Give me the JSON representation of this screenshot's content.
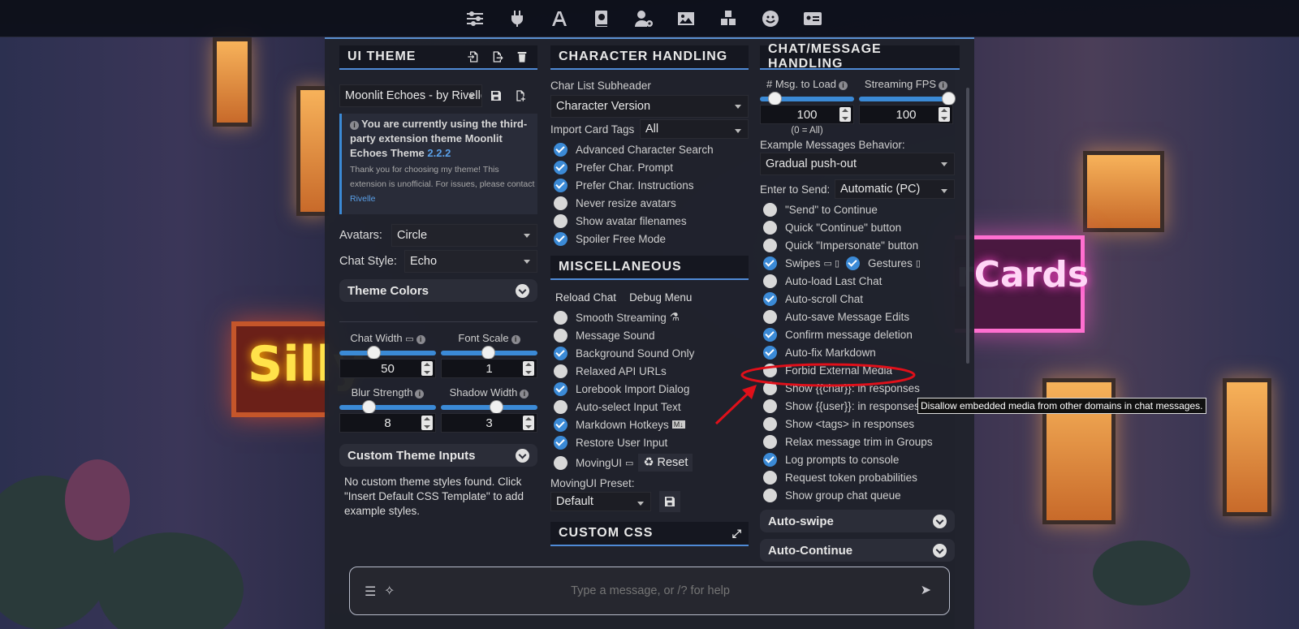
{
  "toolbar": {
    "icons": [
      "sliders-icon",
      "plug-icon",
      "font-icon",
      "book-icon",
      "user-gear-icon",
      "image-icon",
      "cubes-icon",
      "smile-icon",
      "id-card-icon"
    ]
  },
  "background_signs": {
    "left": "Silly",
    "right": "rCards"
  },
  "ui_theme": {
    "title": "UI THEME",
    "theme_select": "Moonlit Echoes - by Rivelle",
    "notice_line1": "You are currently using the third-party extension theme",
    "notice_theme": "Moonlit Echoes Theme",
    "notice_version": "2.2.2",
    "notice_small": "Thank you for choosing my theme! This extension is unofficial. For issues, please contact",
    "notice_contact": "Rivelle",
    "avatars_label": "Avatars:",
    "avatars_value": "Circle",
    "chat_style_label": "Chat Style:",
    "chat_style_value": "Echo",
    "theme_colors": "Theme Colors",
    "chat_width_label": "Chat Width",
    "chat_width_value": "50",
    "font_scale_label": "Font Scale",
    "font_scale_value": "1",
    "blur_label": "Blur Strength",
    "blur_value": "8",
    "shadow_label": "Shadow Width",
    "shadow_value": "3",
    "custom_inputs": "Custom Theme Inputs",
    "custom_inputs_text": "No custom theme styles found. Click \"Insert Default CSS Template\" to add example styles."
  },
  "character": {
    "title": "CHARACTER HANDLING",
    "subheader_label": "Char List Subheader",
    "subheader_value": "Character Version",
    "import_tags_label": "Import Card Tags",
    "import_tags_value": "All",
    "options": [
      {
        "label": "Advanced Character Search",
        "checked": true
      },
      {
        "label": "Prefer Char. Prompt",
        "checked": true
      },
      {
        "label": "Prefer Char. Instructions",
        "checked": true
      },
      {
        "label": "Never resize avatars",
        "checked": false
      },
      {
        "label": "Show avatar filenames",
        "checked": false
      },
      {
        "label": "Spoiler Free Mode",
        "checked": true
      }
    ]
  },
  "misc": {
    "title": "MISCELLANEOUS",
    "reload_chat": "Reload Chat",
    "debug_menu": "Debug Menu",
    "options": [
      {
        "label": "Smooth Streaming",
        "checked": false
      },
      {
        "label": "Message Sound",
        "checked": false
      },
      {
        "label": "Background Sound Only",
        "checked": true
      },
      {
        "label": "Relaxed API URLs",
        "checked": false
      },
      {
        "label": "Lorebook Import Dialog",
        "checked": true
      },
      {
        "label": "Auto-select Input Text",
        "checked": false
      },
      {
        "label": "Markdown Hotkeys",
        "checked": true
      },
      {
        "label": "Restore User Input",
        "checked": true
      }
    ],
    "movingui_label": "MovingUI",
    "reset_label": "Reset",
    "movingui_preset_label": "MovingUI Preset:",
    "movingui_preset_value": "Default",
    "custom_css_title": "CUSTOM CSS"
  },
  "chat": {
    "title": "CHAT/MESSAGE HANDLING",
    "msg_load_label": "# Msg. to Load",
    "msg_load_value": "100",
    "msg_load_note": "(0 = All)",
    "fps_label": "Streaming FPS",
    "fps_value": "100",
    "example_behavior_label": "Example Messages Behavior:",
    "example_behavior_value": "Gradual push-out",
    "enter_send_label": "Enter to Send:",
    "enter_send_value": "Automatic (PC)",
    "options": [
      {
        "label": "\"Send\" to Continue",
        "checked": false
      },
      {
        "label": "Quick \"Continue\" button",
        "checked": false
      },
      {
        "label": "Quick \"Impersonate\" button",
        "checked": false
      },
      {
        "label": "Swipes",
        "checked": true
      },
      {
        "label": "Auto-load Last Chat",
        "checked": false
      },
      {
        "label": "Auto-scroll Chat",
        "checked": true
      },
      {
        "label": "Auto-save Message Edits",
        "checked": false
      },
      {
        "label": "Confirm message deletion",
        "checked": true
      },
      {
        "label": "Auto-fix Markdown",
        "checked": true
      },
      {
        "label": "Forbid External Media",
        "checked": false
      },
      {
        "label": "Show {{char}}: in responses",
        "checked": false
      },
      {
        "label": "Show {{user}}: in responses",
        "checked": false
      },
      {
        "label": "Show <tags> in responses",
        "checked": false
      },
      {
        "label": "Relax message trim in Groups",
        "checked": false
      },
      {
        "label": "Log prompts to console",
        "checked": true
      },
      {
        "label": "Request token probabilities",
        "checked": false
      },
      {
        "label": "Show group chat queue",
        "checked": false
      }
    ],
    "gestures_label": "Gestures",
    "auto_swipe": "Auto-swipe",
    "auto_continue": "Auto-Continue"
  },
  "tooltip": "Disallow embedded media from other domains in chat messages.",
  "input": {
    "placeholder": "Type a message, or /? for help"
  },
  "colors": {
    "accent": "#3b8ad6",
    "highlight": "#e0101a"
  }
}
